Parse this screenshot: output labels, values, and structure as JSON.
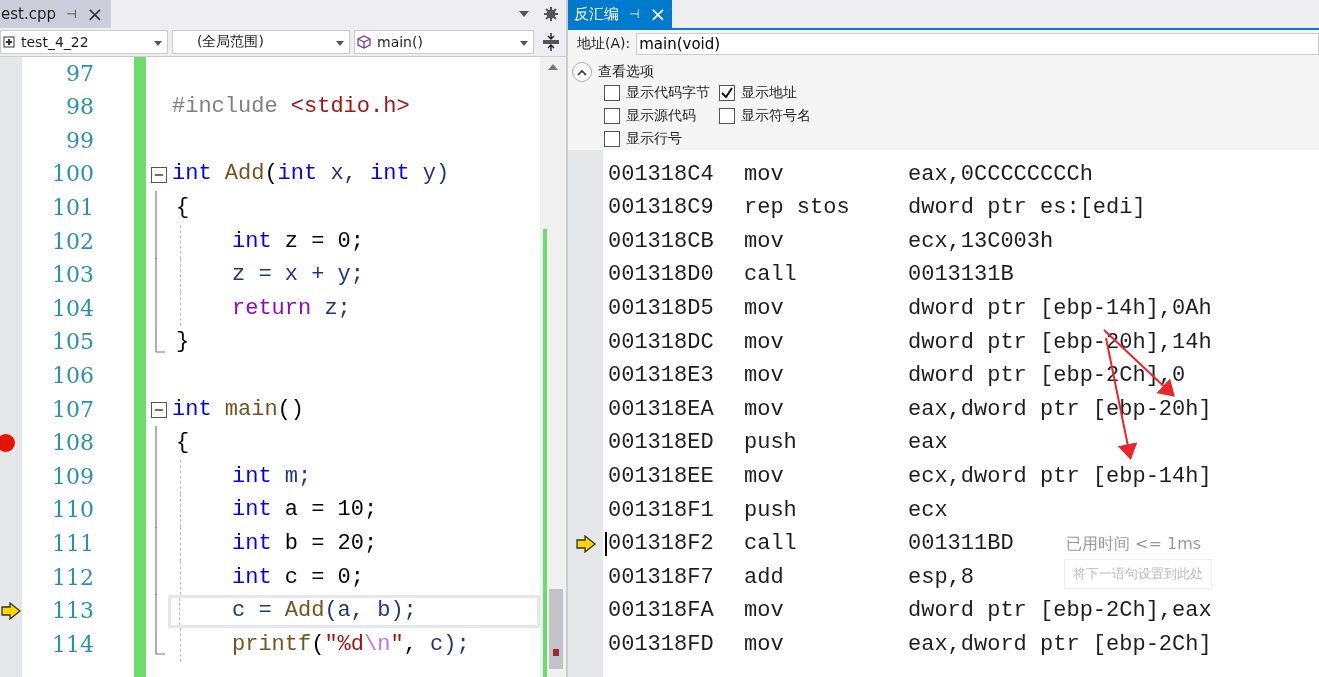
{
  "editor": {
    "tab": {
      "title": "est.cpp",
      "pin": "⊣",
      "close": "×"
    },
    "nav": {
      "project": "test_4_22",
      "scope": "(全局范围)",
      "member": "main()"
    },
    "lines": [
      {
        "number": "97",
        "kind": "plain",
        "breakpoint": false,
        "current": false
      },
      {
        "number": "98",
        "kind": "plain",
        "breakpoint": false,
        "current": false,
        "tokens": [
          {
            "text": "#include",
            "kind": "pre"
          },
          {
            "text": "<stdio.h>",
            "kind": "str"
          }
        ]
      },
      {
        "number": "99",
        "kind": "plain",
        "breakpoint": false,
        "current": false
      },
      {
        "number": "100",
        "kind": "fold",
        "breakpoint": false,
        "current": false,
        "tokens": [
          {
            "text": "int",
            "kind": "kw"
          },
          {
            "text": "Add",
            "kind": "fn"
          },
          {
            "text": "(",
            "kind": "plain"
          },
          {
            "text": "int",
            "kind": "kw"
          },
          {
            "text": "x,",
            "kind": "var"
          },
          {
            "text": "int",
            "kind": "kw"
          },
          {
            "text": "y)",
            "kind": "var"
          }
        ],
        "children": [
          {
            "number": "101",
            "kind": "brace",
            "breakpoint": false,
            "current": false,
            "tokens": [
              {
                "text": "{",
                "kind": "plain"
              }
            ]
          },
          {
            "number": "102",
            "kind": "statement",
            "breakpoint": false,
            "current": false,
            "tokens": [
              {
                "text": "int",
                "kind": "kw"
              },
              {
                "text": "z = 0;",
                "kind": "plain"
              }
            ]
          },
          {
            "number": "103",
            "kind": "statement",
            "breakpoint": false,
            "current": false,
            "tokens": [
              {
                "text": "z = x + y;",
                "kind": "var"
              }
            ]
          },
          {
            "number": "104",
            "kind": "statement",
            "breakpoint": false,
            "current": false,
            "tokens": [
              {
                "text": "return",
                "kind": "ret"
              },
              {
                "text": "z;",
                "kind": "var"
              }
            ]
          },
          {
            "number": "105",
            "kind": "brace",
            "breakpoint": false,
            "current": false,
            "tokens": [
              {
                "text": "}",
                "kind": "plain"
              }
            ]
          }
        ]
      },
      {
        "number": "106",
        "kind": "plain",
        "breakpoint": false,
        "current": false
      },
      {
        "number": "107",
        "kind": "fold",
        "breakpoint": false,
        "current": false,
        "tokens": [
          {
            "text": "int",
            "kind": "kw"
          },
          {
            "text": "main",
            "kind": "fn"
          },
          {
            "text": "()",
            "kind": "plain"
          }
        ],
        "children": [
          {
            "number": "108",
            "kind": "brace",
            "breakpoint": true,
            "current": false,
            "tokens": [
              {
                "text": "{",
                "kind": "plain"
              }
            ]
          },
          {
            "number": "109",
            "kind": "statement",
            "breakpoint": false,
            "current": false,
            "tokens": [
              {
                "text": "int",
                "kind": "kw"
              },
              {
                "text": "m;",
                "kind": "var"
              }
            ]
          },
          {
            "number": "110",
            "kind": "statement",
            "breakpoint": false,
            "current": false,
            "tokens": [
              {
                "text": "int",
                "kind": "kw"
              },
              {
                "text": "a = 10;",
                "kind": "plain"
              }
            ]
          },
          {
            "number": "111",
            "kind": "statement",
            "breakpoint": false,
            "current": false,
            "tokens": [
              {
                "text": "int",
                "kind": "kw"
              },
              {
                "text": "b = 20;",
                "kind": "plain"
              }
            ]
          },
          {
            "number": "112",
            "kind": "statement",
            "breakpoint": false,
            "current": false,
            "tokens": [
              {
                "text": "int",
                "kind": "kw"
              },
              {
                "text": "c = 0;",
                "kind": "plain"
              }
            ]
          },
          {
            "number": "113",
            "kind": "statement",
            "breakpoint": false,
            "current": true,
            "tokens": [
              {
                "text": "c =",
                "kind": "var"
              },
              {
                "text": "Add",
                "kind": "fn"
              },
              {
                "text": "(a, b);",
                "kind": "var"
              }
            ]
          },
          {
            "number": "114",
            "kind": "statement",
            "breakpoint": false,
            "current": false,
            "tokens": [
              {
                "text": "printf",
                "kind": "fn"
              },
              {
                "text": "(",
                "kind": "plain"
              },
              {
                "text": "\"%d",
                "kind": "str"
              },
              {
                "text": "\\n",
                "kind": "esc"
              },
              {
                "text": "\"",
                "kind": "str"
              },
              {
                "text": ",",
                "kind": "plain"
              },
              {
                "text": "c);",
                "kind": "var"
              }
            ]
          }
        ]
      }
    ]
  },
  "disassembly": {
    "tab": {
      "title": "反汇编",
      "pin": "⊣",
      "close": "×"
    },
    "address_label": "地址(A):",
    "address": "main(void)",
    "options": {
      "title": "查看选项",
      "expanded": true,
      "items": [
        {
          "label": "显示代码字节",
          "checked": false
        },
        {
          "label": "显示地址",
          "checked": true
        },
        {
          "label": "显示源代码",
          "checked": false
        },
        {
          "label": "显示符号名",
          "checked": false
        },
        {
          "label": "显示行号",
          "checked": false
        }
      ]
    },
    "rows": [
      {
        "address": "001318C4",
        "op": "mov",
        "arg": "eax,0CCCCCCCCh",
        "current": false
      },
      {
        "address": "001318C9",
        "op": "rep stos",
        "arg": "dword ptr es:[edi]",
        "current": false
      },
      {
        "address": "001318CB",
        "op": "mov",
        "arg": "ecx,13C003h",
        "current": false
      },
      {
        "address": "001318D0",
        "op": "call",
        "arg": "0013131B",
        "current": false
      },
      {
        "address": "001318D5",
        "op": "mov",
        "arg": "dword ptr [ebp-14h],0Ah",
        "current": false
      },
      {
        "address": "001318DC",
        "op": "mov",
        "arg": "dword ptr [ebp-20h],14h",
        "current": false
      },
      {
        "address": "001318E3",
        "op": "mov",
        "arg": "dword ptr [ebp-2Ch],0",
        "current": false
      },
      {
        "address": "001318EA",
        "op": "mov",
        "arg": "eax,dword ptr [ebp-20h]",
        "current": false
      },
      {
        "address": "001318ED",
        "op": "push",
        "arg": "eax",
        "current": false
      },
      {
        "address": "001318EE",
        "op": "mov",
        "arg": "ecx,dword ptr [ebp-14h]",
        "current": false
      },
      {
        "address": "001318F1",
        "op": "push",
        "arg": "ecx",
        "current": false
      },
      {
        "address": "001318F2",
        "op": "call",
        "arg": "001311BD",
        "current": true,
        "elapsed": "已用时间 <= 1ms"
      },
      {
        "address": "001318F7",
        "op": "add",
        "arg": "esp,8",
        "current": false,
        "hint": "将下一语句设置到此处"
      },
      {
        "address": "001318FA",
        "op": "mov",
        "arg": "dword ptr [ebp-2Ch],eax",
        "current": false
      },
      {
        "address": "001318FD",
        "op": "mov",
        "arg": "eax,dword ptr [ebp-2Ch]",
        "current": false
      }
    ]
  }
}
